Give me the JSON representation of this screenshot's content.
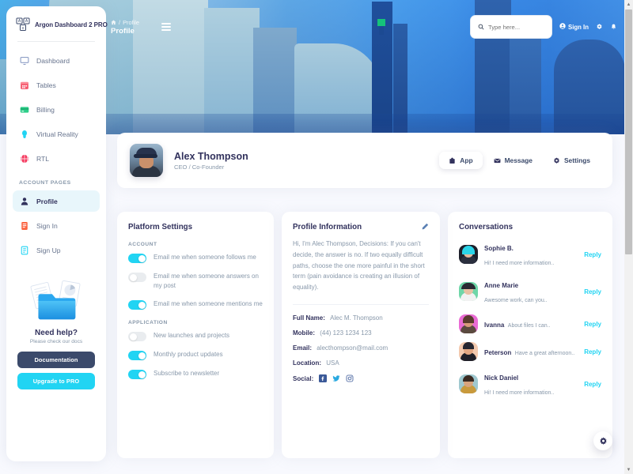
{
  "brand": {
    "name": "Argon Dashboard 2 PRO",
    "logo_icon": "argon-logo-icon"
  },
  "sidebar": {
    "items": [
      {
        "label": "Dashboard",
        "icon": "desktop-icon",
        "color": "#8e9fc6",
        "active": false
      },
      {
        "label": "Tables",
        "icon": "calendar-icon",
        "color": "#f5576c",
        "active": false
      },
      {
        "label": "Billing",
        "icon": "credit-card-icon",
        "color": "#2dce89",
        "active": false
      },
      {
        "label": "Virtual Reality",
        "icon": "vr-headset-icon",
        "color": "#21d4f3",
        "active": false
      },
      {
        "label": "RTL",
        "icon": "globe-icon",
        "color": "#f5365c",
        "active": false
      }
    ],
    "section_label": "ACCOUNT PAGES",
    "account_items": [
      {
        "label": "Profile",
        "icon": "user-icon",
        "color": "#32325d",
        "active": true
      },
      {
        "label": "Sign In",
        "icon": "signin-icon",
        "color": "#fb6340",
        "active": false
      },
      {
        "label": "Sign Up",
        "icon": "signup-icon",
        "color": "#21d4f3",
        "active": false
      }
    ],
    "help": {
      "illustration": "documents-folder-illustration",
      "title": "Need help?",
      "subtitle": "Please check our docs",
      "doc_button": "Documentation",
      "pro_button": "Upgrade to PRO"
    }
  },
  "topnav": {
    "breadcrumb_home_icon": "home-icon",
    "breadcrumb_sep": "/",
    "breadcrumb_parent": "Profile",
    "breadcrumb_current": "Profile",
    "burger_icon": "hamburger-menu-icon",
    "search": {
      "icon": "search-icon",
      "placeholder": "Type here...",
      "value": ""
    },
    "signin_label": "Sign In",
    "signin_icon": "user-circle-icon",
    "gear_icon": "gear-icon",
    "bell_icon": "bell-icon"
  },
  "profile_card": {
    "avatar": "alex-thompson-avatar",
    "name": "Alex Thompson",
    "role": "CEO / Co-Founder",
    "buttons": [
      {
        "label": "App",
        "icon": "app-icon",
        "selected": true
      },
      {
        "label": "Message",
        "icon": "envelope-icon",
        "selected": false
      },
      {
        "label": "Settings",
        "icon": "gear-icon",
        "selected": false
      }
    ]
  },
  "platform_settings": {
    "title": "Platform Settings",
    "account_label": "ACCOUNT",
    "account_toggles": [
      {
        "label": "Email me when someone follows me",
        "on": true
      },
      {
        "label": "Email me when someone answers on my post",
        "on": false
      },
      {
        "label": "Email me when someone mentions me",
        "on": true
      }
    ],
    "application_label": "APPLICATION",
    "application_toggles": [
      {
        "label": "New launches and projects",
        "on": false
      },
      {
        "label": "Monthly product updates",
        "on": true
      },
      {
        "label": "Subscribe to newsletter",
        "on": true
      }
    ]
  },
  "profile_information": {
    "title": "Profile Information",
    "edit_icon": "pencil-icon",
    "bio": "Hi, I'm Alec Thompson, Decisions: If you can't decide, the answer is no. If two equally difficult paths, choose the one more painful in the short term (pain avoidance is creating an illusion of equality).",
    "fields": [
      {
        "key": "Full Name:",
        "value": "Alec M. Thompson"
      },
      {
        "key": "Mobile:",
        "value": "(44) 123 1234 123"
      },
      {
        "key": "Email:",
        "value": "alecthompson@mail.com"
      },
      {
        "key": "Location:",
        "value": "USA"
      }
    ],
    "social_label": "Social:",
    "social_icons": [
      "facebook-icon",
      "twitter-icon",
      "instagram-icon"
    ]
  },
  "conversations": {
    "title": "Conversations",
    "reply_label": "Reply",
    "items": [
      {
        "name": "Sophie B.",
        "message": "Hi! I need more information..",
        "av_bg": "#1d1f2a",
        "av_hair": "#2bd4e8",
        "av_skin": "#e6b79a"
      },
      {
        "name": "Anne Marie",
        "message": "Awesome work, can you..",
        "av_bg": "#6fd6a8",
        "av_hair": "#2a2a33",
        "av_skin": "#e8c0a4"
      },
      {
        "name": "Ivanna",
        "message": "About files I can..",
        "av_bg": "#ea6bd4",
        "av_hair": "#5a3b2e",
        "av_skin": "#d79b7a"
      },
      {
        "name": "Peterson",
        "message": "Have a great afternoon..",
        "av_bg": "#f3c9ae",
        "av_hair": "#262630",
        "av_skin": "#e3a783"
      },
      {
        "name": "Nick Daniel",
        "message": "Hi! I need more information..",
        "av_bg": "#9fc8cf",
        "av_hair": "#3a2a22",
        "av_skin": "#d8a47e"
      }
    ]
  },
  "fab": {
    "icon": "gear-icon"
  },
  "scrollbar": {
    "up_arrow": "▲",
    "down_arrow": "▼"
  }
}
